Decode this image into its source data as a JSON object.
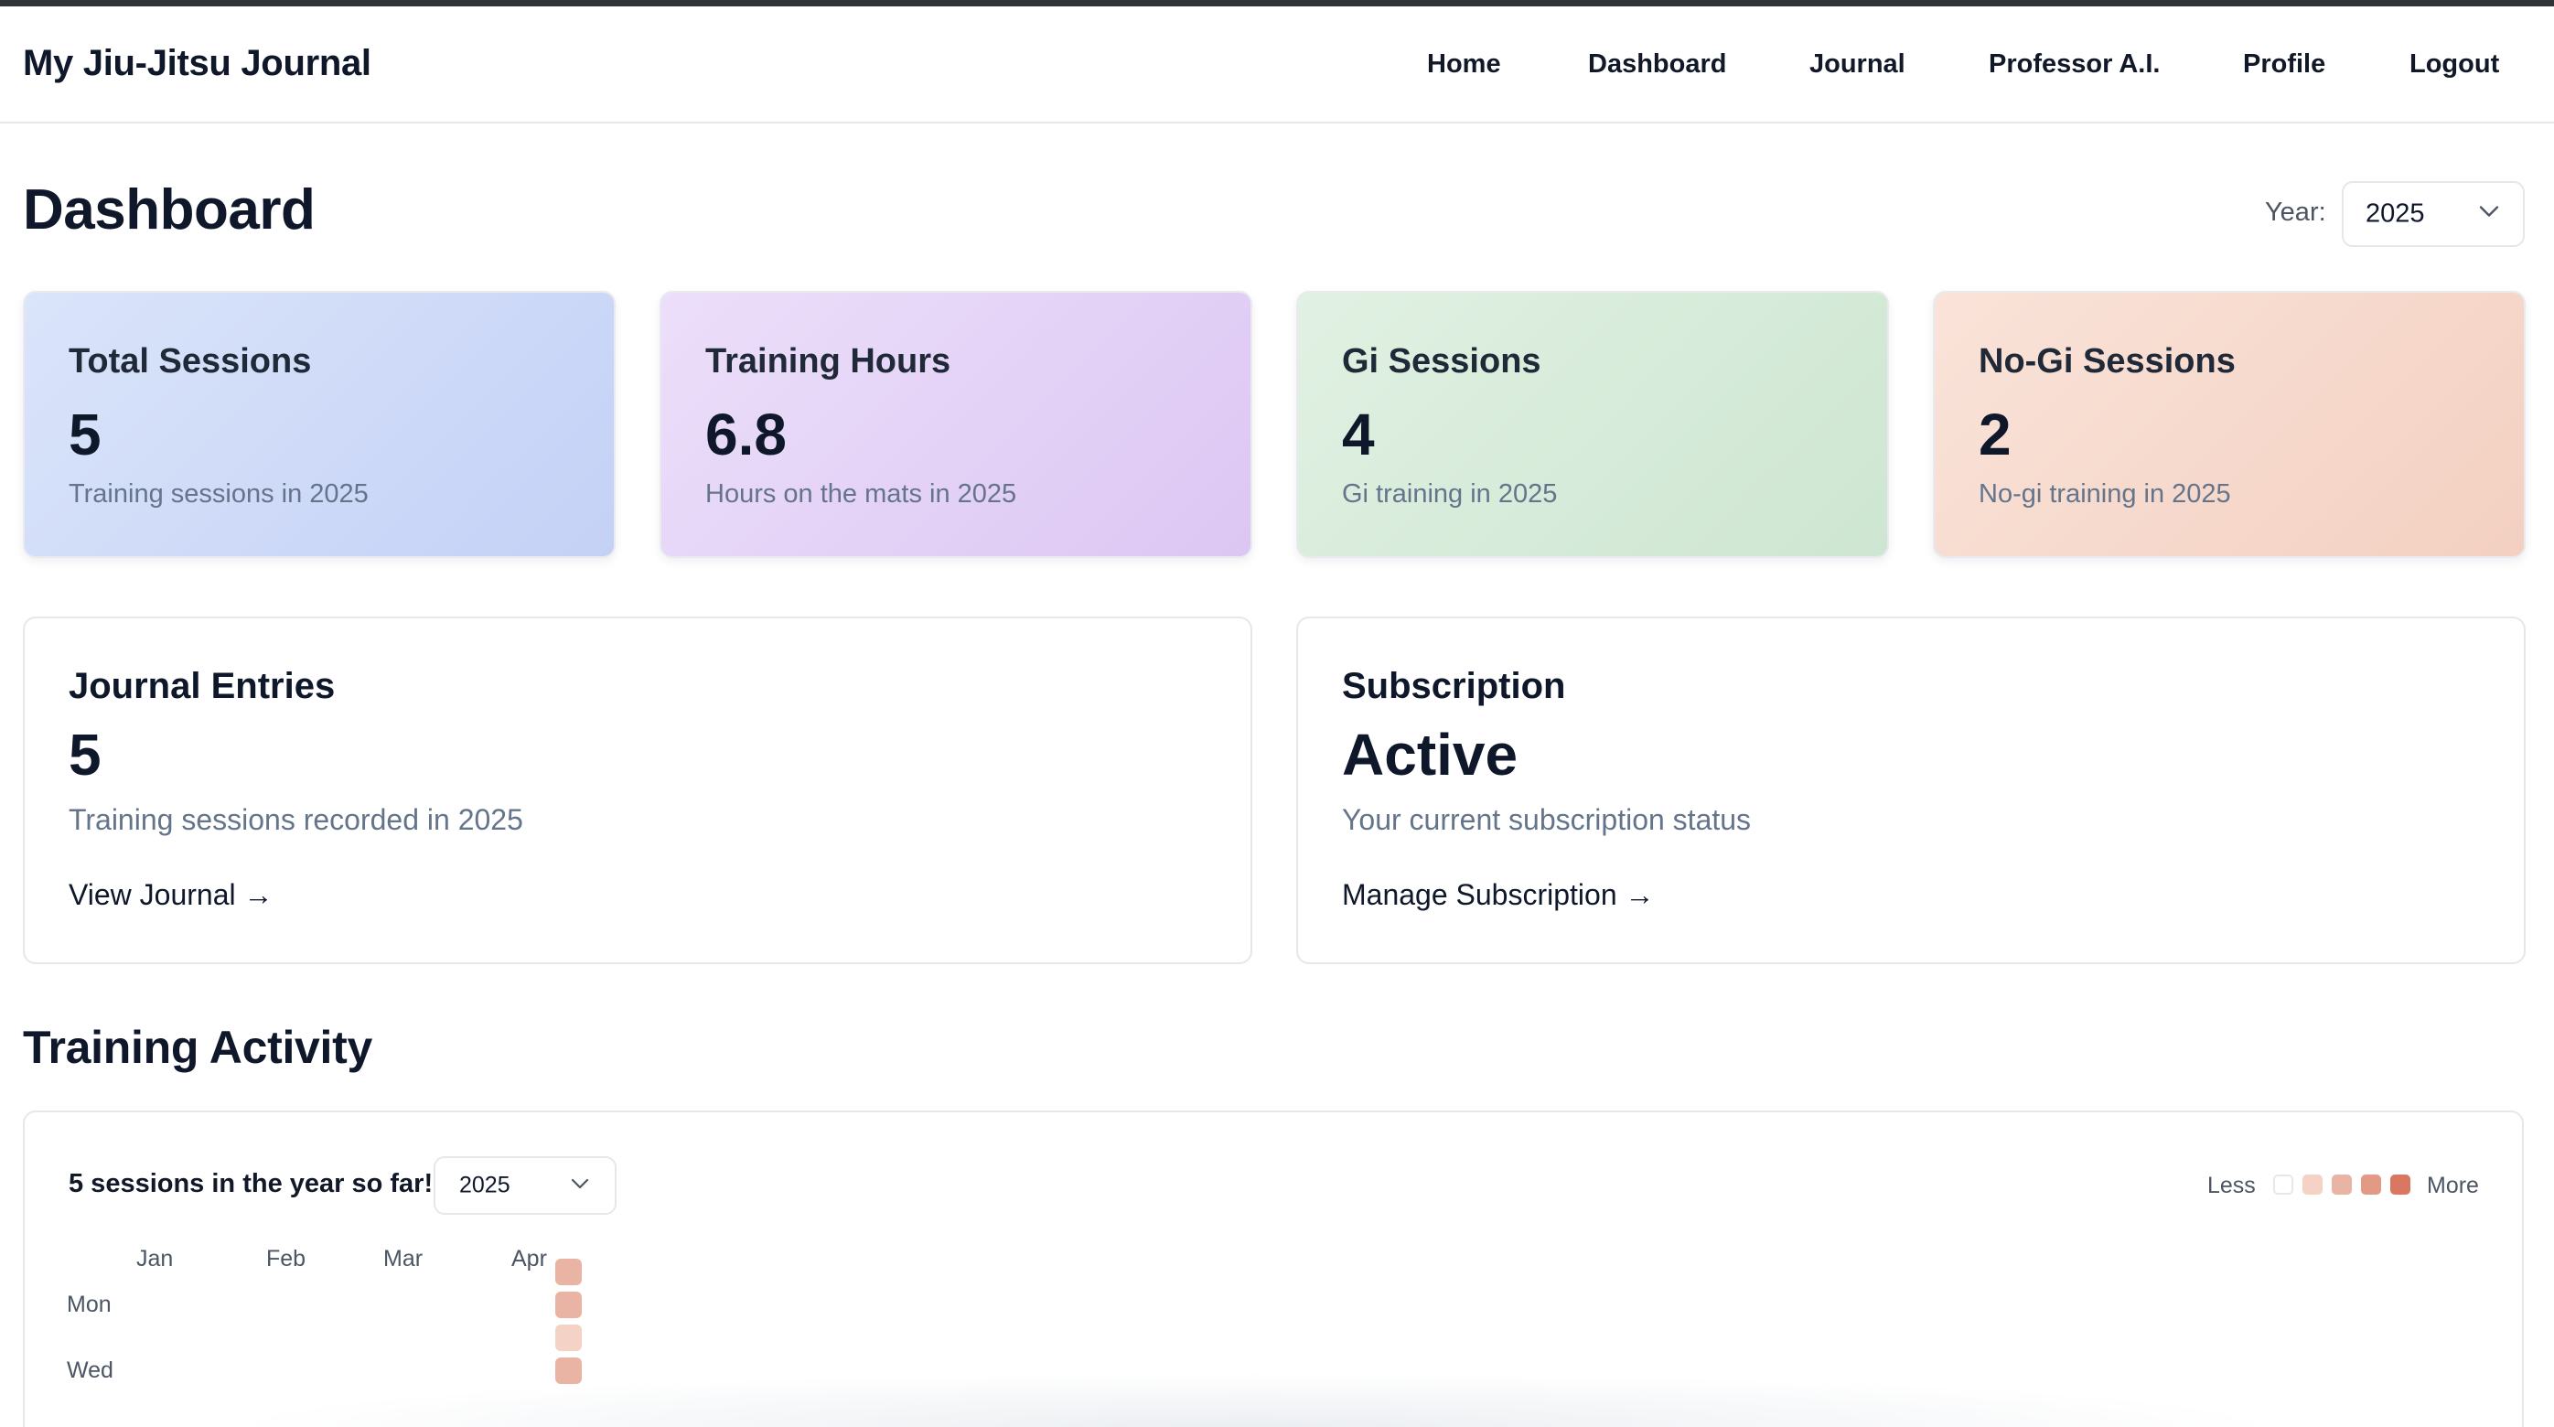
{
  "nav": {
    "brand": "My Jiu-Jitsu Journal",
    "links": [
      "Home",
      "Dashboard",
      "Journal",
      "Professor A.I.",
      "Profile",
      "Logout"
    ]
  },
  "header": {
    "title": "Dashboard",
    "year_label": "Year:",
    "year_value": "2025"
  },
  "stats": [
    {
      "title": "Total Sessions",
      "value": "5",
      "subtitle": "Training sessions in 2025"
    },
    {
      "title": "Training Hours",
      "value": "6.8",
      "subtitle": "Hours on the mats in 2025"
    },
    {
      "title": "Gi Sessions",
      "value": "4",
      "subtitle": "Gi training in 2025"
    },
    {
      "title": "No-Gi Sessions",
      "value": "2",
      "subtitle": "No-gi training in 2025"
    }
  ],
  "journal_card": {
    "title": "Journal Entries",
    "value": "5",
    "subtitle": "Training sessions recorded in 2025",
    "link": "View Journal →"
  },
  "subscription_card": {
    "title": "Subscription",
    "value": "Active",
    "subtitle": "Your current subscription status",
    "link": "Manage Subscription →"
  },
  "activity": {
    "section_title": "Training Activity",
    "count_text": "5 sessions in the year so far!",
    "year_value": "2025",
    "legend_less": "Less",
    "legend_more": "More",
    "legend_colors": [
      "#ffffff",
      "#f5d2c6",
      "#eab4a4",
      "#e39a84",
      "#d97761"
    ],
    "months": [
      "Jan",
      "Feb",
      "Mar",
      "Apr"
    ],
    "days": [
      "Mon",
      "Wed"
    ],
    "cells": [
      {
        "row": 0,
        "level": 2
      },
      {
        "row": 1,
        "level": 2
      },
      {
        "row": 2,
        "level": 1
      },
      {
        "row": 3,
        "level": 2
      }
    ]
  },
  "colors": {
    "total_gradient": [
      "#dae4fa",
      "#c4d1f6"
    ],
    "hours_gradient": [
      "#ecdffa",
      "#dcc6f3"
    ],
    "gi_gradient": [
      "#e1f1e3",
      "#cde6d1"
    ],
    "nogi_gradient": [
      "#fae3d9",
      "#f3d0c1"
    ]
  }
}
